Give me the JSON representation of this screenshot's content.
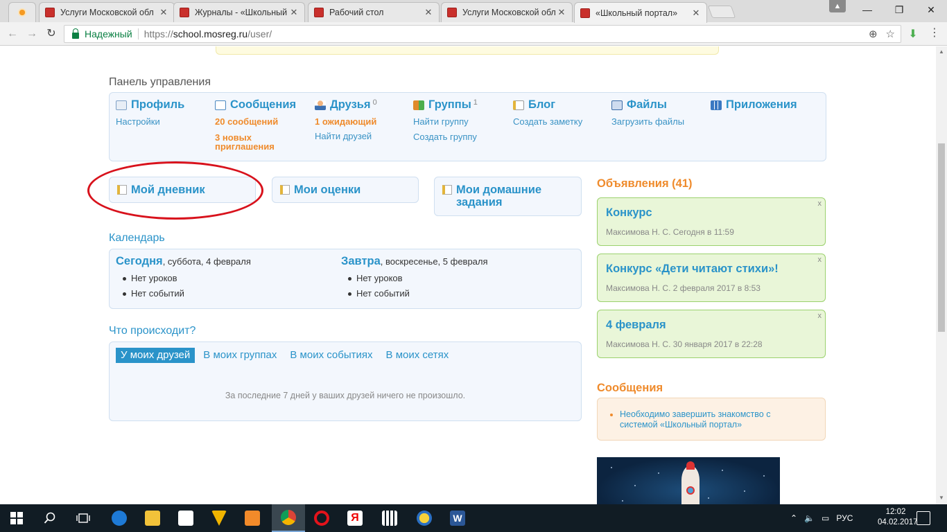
{
  "browser": {
    "tabs": [
      {
        "title": "",
        "favicon": "sun-favicon",
        "active": false
      },
      {
        "title": "Услуги Московской обл",
        "favicon": "mosreg-favicon",
        "active": false
      },
      {
        "title": "Журналы - «Школьный",
        "favicon": "mosreg-favicon",
        "active": false
      },
      {
        "title": "Рабочий стол",
        "favicon": "mosreg-favicon",
        "active": false
      },
      {
        "title": "Услуги Московской обл",
        "favicon": "mosreg-favicon",
        "active": false
      },
      {
        "title": "«Школьный портал»",
        "favicon": "mosreg-favicon",
        "active": true
      }
    ],
    "secure_label": "Надежный",
    "url_scheme": "https://",
    "url_host": "school.mosreg.ru",
    "url_path": "/user/"
  },
  "panel": {
    "heading": "Панель управления",
    "profile": {
      "title": "Профиль",
      "link1": "Настройки"
    },
    "messages": {
      "title": "Сообщения",
      "count": "20 сообщений",
      "invites": "3 новых приглашения"
    },
    "friends": {
      "title": "Друзья",
      "sup": "0",
      "pending": "1 ожидающий",
      "link1": "Найти друзей"
    },
    "groups": {
      "title": "Группы",
      "sup": "1",
      "link1": "Найти группу",
      "link2": "Создать группу"
    },
    "blog": {
      "title": "Блог",
      "link1": "Создать заметку"
    },
    "files": {
      "title": "Файлы",
      "link1": "Загрузить файлы"
    },
    "apps": {
      "title": "Приложения"
    }
  },
  "quick": {
    "diary": "Мой дневник",
    "grades": "Мои оценки",
    "homework": "Мои домашние задания"
  },
  "calendar": {
    "heading": "Календарь",
    "today_label": "Сегодня",
    "today_date": ", суббота, 4 февраля",
    "today_items": [
      "Нет уроков",
      "Нет событий"
    ],
    "tomorrow_label": "Завтра",
    "tomorrow_date": ", воскресенье, 5 февраля",
    "tomorrow_items": [
      "Нет уроков",
      "Нет событий"
    ]
  },
  "feed": {
    "heading": "Что происходит?",
    "tabs": [
      "У моих друзей",
      "В моих группах",
      "В моих событиях",
      "В моих сетях"
    ],
    "empty_text": "За последние 7 дней у ваших друзей ничего не произошло."
  },
  "announcements": {
    "heading": "Объявления (41)",
    "items": [
      {
        "title": "Конкурс",
        "meta": "Максимова Н. С. Сегодня в 11:59"
      },
      {
        "title": "Конкурс «Дети читают стихи»!",
        "meta": "Максимова Н. С. 2 февраля 2017 в 8:53"
      },
      {
        "title": "4 февраля",
        "meta": "Максимова Н. С. 30 января 2017 в 22:28"
      }
    ]
  },
  "messages_block": {
    "heading": "Сообщения",
    "item": "Необходимо завершить знакомство с системой «Школьный портал»"
  },
  "taskbar": {
    "lang": "РУС",
    "time": "12:02",
    "date": "04.02.2017"
  },
  "colors": {
    "link": "#2a93c9",
    "accent_orange": "#ef8b2c",
    "annotation_red": "#d8121c"
  }
}
